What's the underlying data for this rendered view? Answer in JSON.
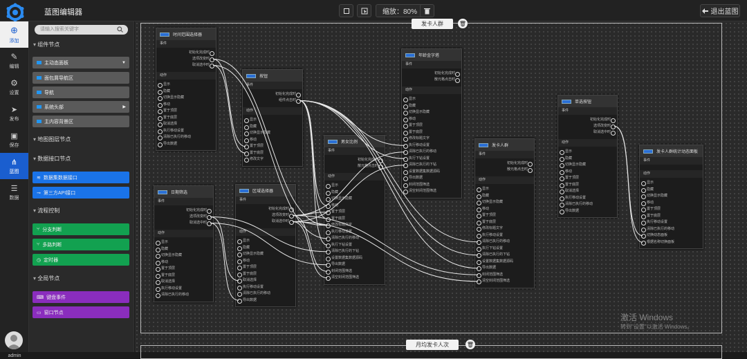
{
  "app": {
    "title": "蓝图编辑器",
    "admin": "admin",
    "exit_label": "退出蓝图",
    "zoom_label": "缩放：80%"
  },
  "rail": [
    {
      "label": "添加",
      "icon": "add-icon"
    },
    {
      "label": "编辑",
      "icon": "edit-icon"
    },
    {
      "label": "设置",
      "icon": "gear-icon"
    },
    {
      "label": "发布",
      "icon": "send-icon"
    },
    {
      "label": "保存",
      "icon": "save-icon"
    },
    {
      "label": "蓝图",
      "icon": "blueprint-icon"
    },
    {
      "label": "数据",
      "icon": "database-icon"
    }
  ],
  "panel": {
    "search_placeholder": "请输入搜索关键字",
    "sections": [
      "组件节点",
      "地图图层节点",
      "数据接口节点",
      "流程控制",
      "全局节点"
    ],
    "components": [
      "主动态面板",
      "面包屑导航区",
      "导航",
      "系统头部",
      "主内容背景区"
    ],
    "data_interfaces": [
      "数据集数据接口",
      "第三方API接口"
    ],
    "flow": [
      "分支判断",
      "多路判断",
      "定时器"
    ],
    "global": [
      "键盘事件",
      "窗口节点"
    ]
  },
  "groups": {
    "g1": "发卡人群",
    "g2": "月均发卡人次"
  },
  "labels": {
    "events": "事件",
    "actions": "动作"
  },
  "nodes": [
    {
      "title": "时间范围选择器",
      "events": [
        "初始化完成时",
        "选项改变时",
        "取消选中时"
      ],
      "actions": [
        "显示",
        "隐藏",
        "切换显示隐藏",
        "移动",
        "置于顶层",
        "置于底层",
        "取消选择",
        "执行移动设置",
        "清除已执行的移动",
        "导出数据"
      ]
    },
    {
      "title": "按钮",
      "events": [
        "初始化完成时",
        "组件点击时"
      ],
      "actions": [
        "显示",
        "隐藏",
        "切换显示隐藏",
        "移动",
        "置于顶层",
        "置于底层",
        "修改文字"
      ]
    },
    {
      "title": "日期筛选",
      "events": [
        "初始化完成时",
        "选项改变时",
        "取消选中时"
      ],
      "actions": [
        "显示",
        "隐藏",
        "切换显示隐藏",
        "移动",
        "置于顶层",
        "置于底层",
        "取消选择",
        "执行移动设置",
        "清除已执行的移动"
      ]
    },
    {
      "title": "区域选择器",
      "events": [
        "初始化完成时",
        "选项改变时",
        "取消选中时"
      ],
      "actions": [
        "显示",
        "隐藏",
        "切换显示隐藏",
        "移动",
        "置于顶层",
        "置于底层",
        "取消选择",
        "执行移动设置",
        "清除已执行的移动",
        "导出数据"
      ]
    },
    {
      "title": "男女比例",
      "events": [
        "初始化完成时",
        "散元格点击时"
      ],
      "actions": [
        "显示",
        "隐藏",
        "切换显示隐藏",
        "移动",
        "置于顶层",
        "置于底层",
        "修改标题文字",
        "执行移动设置",
        "清除已执行的移动",
        "执行下钻设置",
        "清除已执行的下钻",
        "设置数据集数据源码",
        "导出数据",
        "封闭范围筛选",
        "清空封闭范围筛选"
      ]
    },
    {
      "title": "年龄金字塔",
      "events": [
        "初始化完成时",
        "散元格点击时"
      ],
      "actions": [
        "显示",
        "隐藏",
        "切换显示隐藏",
        "移动",
        "置于顶层",
        "置于底层",
        "修改标题文字",
        "执行移动设置",
        "清除已执行的移动",
        "执行下钻设置",
        "清除已执行的下钻",
        "设置数据集数据源码",
        "导出数据",
        "封闭范围筛选",
        "清空封闭范围筛选"
      ]
    },
    {
      "title": "发卡人群",
      "events": [
        "初始化完成时",
        "散元格点击时"
      ],
      "actions": [
        "显示",
        "隐藏",
        "切换显示隐藏",
        "移动",
        "置于顶层",
        "置于底层",
        "修改标题文字",
        "执行移动设置",
        "清除已执行的移动",
        "执行下钻设置",
        "清除已执行的下钻",
        "设置数据集数据源码",
        "导出数据",
        "封闭范围筛选",
        "清空封闭范围筛选"
      ]
    },
    {
      "title": "单选按钮",
      "events": [
        "初始化完成时",
        "选项改变时",
        "取消选中时"
      ],
      "actions": [
        "显示",
        "隐藏",
        "切换显示隐藏",
        "移动",
        "置于顶层",
        "置于底层",
        "取消选择",
        "执行移动设置",
        "清除已执行的移动",
        "导出数据"
      ]
    },
    {
      "title": "发卡人群统计动态面板",
      "events": [],
      "actions": [
        "显示",
        "隐藏",
        "切换显示隐藏",
        "移动",
        "置于顶层",
        "置于底层",
        "执行移动设置",
        "清除已执行的移动",
        "切换动态面板",
        "根据名称切换面板"
      ]
    }
  ],
  "watermark": {
    "line1": "激活 Windows",
    "line2": "转到\"设置\"以激活 Windows。"
  }
}
